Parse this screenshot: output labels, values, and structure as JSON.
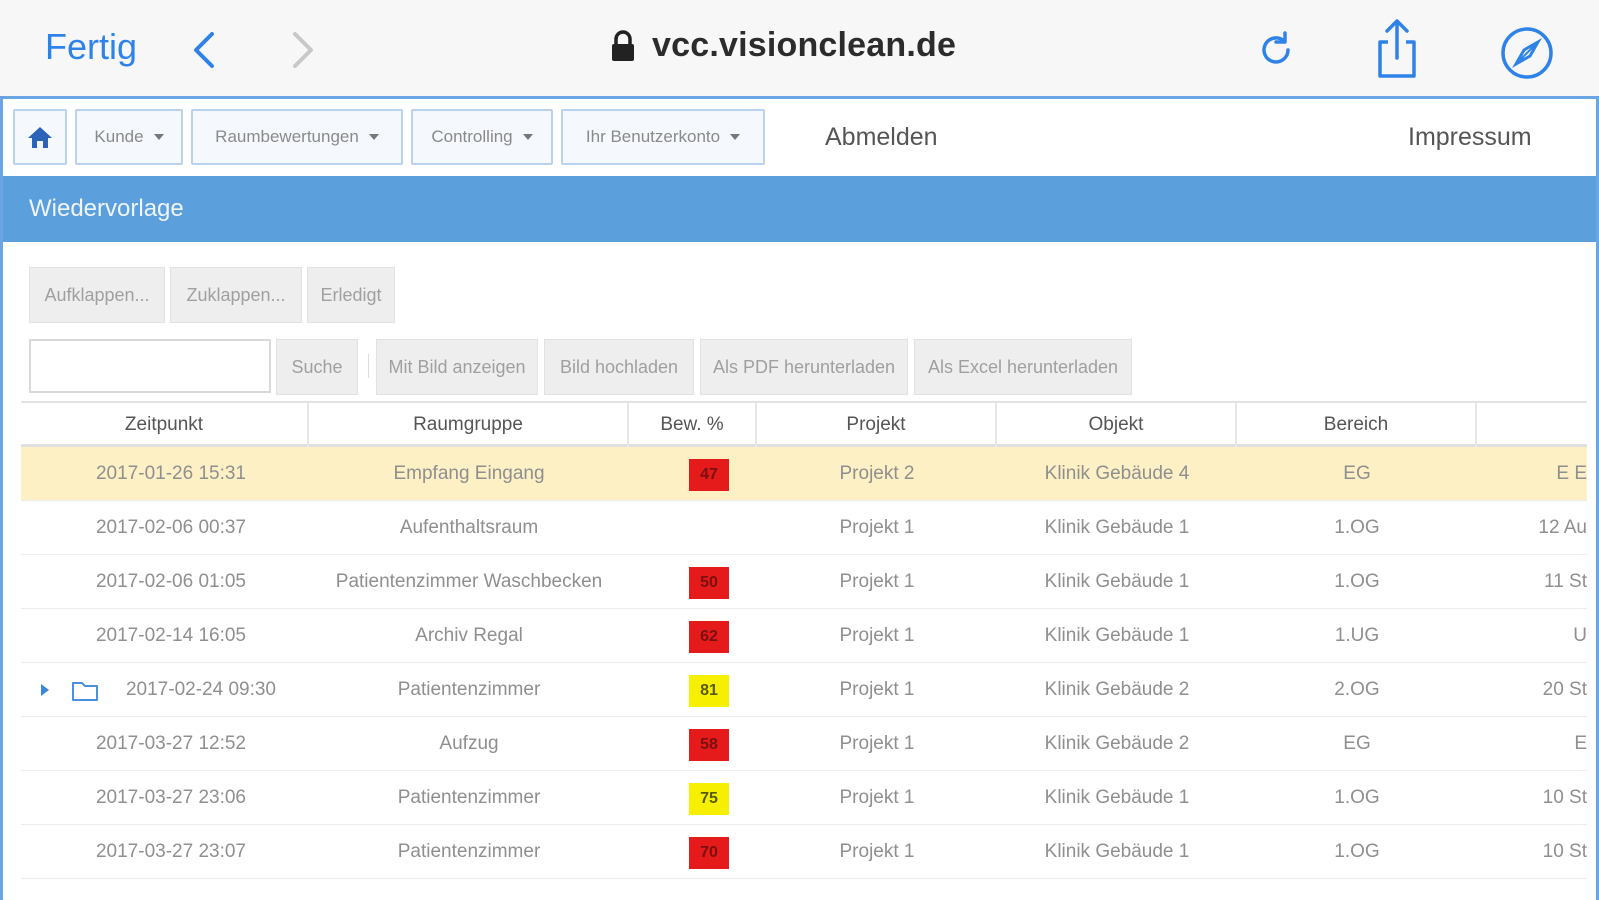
{
  "browser": {
    "done_label": "Fertig",
    "url": "vcc.visionclean.de",
    "icons": [
      "back-chevron-icon",
      "forward-chevron-icon",
      "lock-icon",
      "reload-icon",
      "share-icon",
      "compass-icon"
    ]
  },
  "navbar": {
    "home_icon": "home-icon",
    "menus": [
      {
        "label": "Kunde"
      },
      {
        "label": "Raumbewertungen"
      },
      {
        "label": "Controlling"
      },
      {
        "label": "Ihr Benutzerkonto"
      }
    ],
    "logout_label": "Abmelden",
    "impressum_label": "Impressum"
  },
  "panel": {
    "title": "Wiedervorlage"
  },
  "toolbar": {
    "expand_label": "Aufklappen...",
    "collapse_label": "Zuklappen...",
    "done_label": "Erledigt",
    "search_value": "",
    "search_label": "Suche",
    "show_image_label": "Mit Bild anzeigen",
    "upload_image_label": "Bild hochladen",
    "pdf_label": "Als PDF herunterladen",
    "excel_label": "Als Excel herunterladen"
  },
  "table": {
    "columns": [
      "Zeitpunkt",
      "Raumgruppe",
      "Bew. %",
      "Projekt",
      "Objekt",
      "Bereich",
      ""
    ],
    "rows": [
      {
        "zeitpunkt": "2017-01-26 15:31",
        "raumgruppe": "Empfang Eingang",
        "bew": "47",
        "bew_color": "red",
        "projekt": "Projekt 2",
        "objekt": "Klinik Gebäude 4",
        "bereich": "EG",
        "extra": "E E",
        "selected": true
      },
      {
        "zeitpunkt": "2017-02-06 00:37",
        "raumgruppe": "Aufenthaltsraum",
        "bew": "",
        "bew_color": "",
        "projekt": "Projekt 1",
        "objekt": "Klinik Gebäude 1",
        "bereich": "1.OG",
        "extra": "12 Au"
      },
      {
        "zeitpunkt": "2017-02-06 01:05",
        "raumgruppe": "Patientenzimmer Waschbecken",
        "bew": "50",
        "bew_color": "red",
        "projekt": "Projekt 1",
        "objekt": "Klinik Gebäude 1",
        "bereich": "1.OG",
        "extra": "11 St"
      },
      {
        "zeitpunkt": "2017-02-14 16:05",
        "raumgruppe": "Archiv Regal",
        "bew": "62",
        "bew_color": "red",
        "projekt": "Projekt 1",
        "objekt": "Klinik Gebäude 1",
        "bereich": "1.UG",
        "extra": "U"
      },
      {
        "zeitpunkt": "2017-02-24 09:30",
        "raumgruppe": "Patientenzimmer",
        "bew": "81",
        "bew_color": "yellow",
        "projekt": "Projekt 1",
        "objekt": "Klinik Gebäude 2",
        "bereich": "2.OG",
        "extra": "20 St",
        "group": true
      },
      {
        "zeitpunkt": "2017-03-27 12:52",
        "raumgruppe": "Aufzug",
        "bew": "58",
        "bew_color": "red",
        "projekt": "Projekt 1",
        "objekt": "Klinik Gebäude 2",
        "bereich": "EG",
        "extra": "E"
      },
      {
        "zeitpunkt": "2017-03-27 23:06",
        "raumgruppe": "Patientenzimmer",
        "bew": "75",
        "bew_color": "yellow",
        "projekt": "Projekt 1",
        "objekt": "Klinik Gebäude 1",
        "bereich": "1.OG",
        "extra": "10 St"
      },
      {
        "zeitpunkt": "2017-03-27 23:07",
        "raumgruppe": "Patientenzimmer",
        "bew": "70",
        "bew_color": "red",
        "projekt": "Projekt 1",
        "objekt": "Klinik Gebäude 1",
        "bereich": "1.OG",
        "extra": "10 St"
      }
    ]
  },
  "colors": {
    "safari_blue": "#2f83e8",
    "title_bar": "#5c9fdd",
    "selected_row": "#fdf0c5",
    "badge_red": "#e51b1b",
    "badge_yellow": "#f6f000"
  }
}
